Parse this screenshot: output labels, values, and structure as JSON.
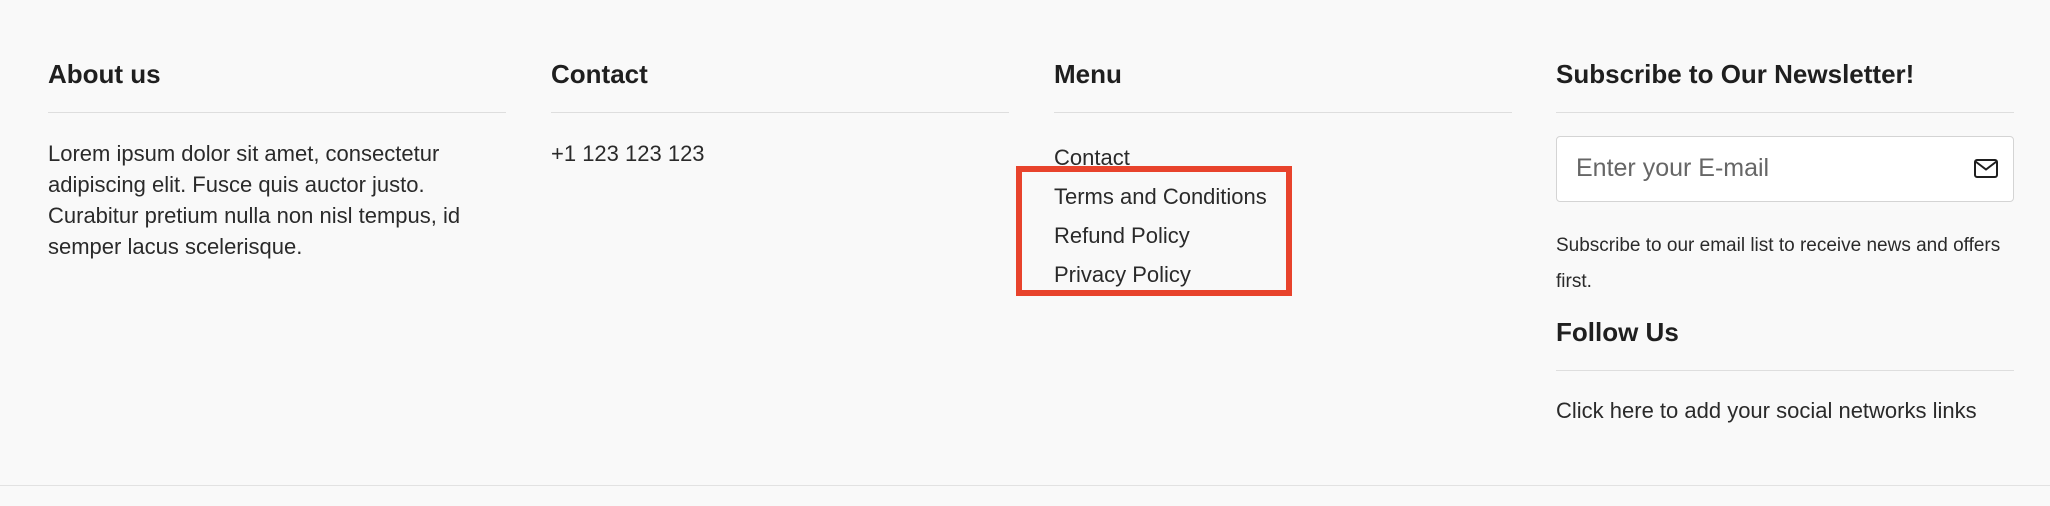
{
  "about": {
    "heading": "About us",
    "text": "Lorem ipsum dolor sit amet, consectetur adipiscing elit. Fusce quis auctor justo. Curabitur pretium nulla non nisl tempus, id semper lacus scelerisque."
  },
  "contact": {
    "heading": "Contact",
    "phone": "+1 123 123 123"
  },
  "menu": {
    "heading": "Menu",
    "items": [
      {
        "label": "Contact"
      },
      {
        "label": "Terms and Conditions"
      },
      {
        "label": "Refund Policy"
      },
      {
        "label": "Privacy Policy"
      }
    ]
  },
  "newsletter": {
    "heading": "Subscribe to Our Newsletter!",
    "email_placeholder": "Enter your E-mail",
    "email_value": "",
    "submit_icon": "envelope-icon",
    "description": "Subscribe to our email list to receive news and offers first."
  },
  "follow": {
    "heading": "Follow Us",
    "link_text": "Click here to add your social networks links"
  },
  "highlight": {
    "color": "#e8432c"
  }
}
